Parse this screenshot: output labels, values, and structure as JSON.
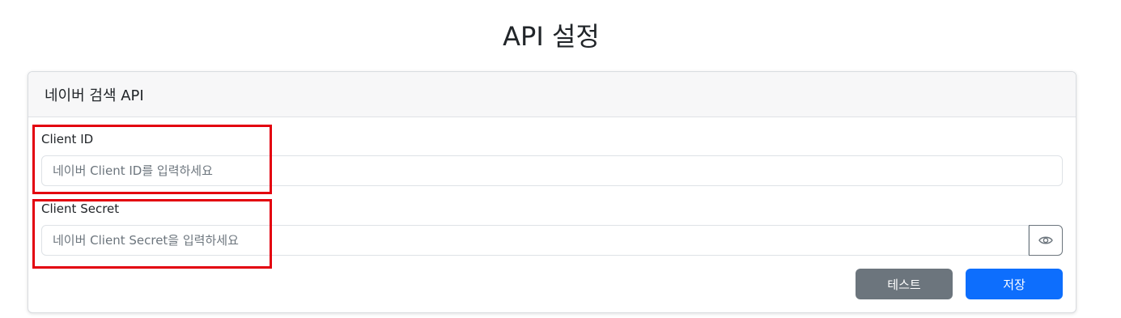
{
  "page": {
    "title": "API 설정"
  },
  "card": {
    "header": "네이버 검색 API",
    "client_id": {
      "label": "Client ID",
      "value": "",
      "placeholder": "네이버 Client ID를 입력하세요"
    },
    "client_secret": {
      "label": "Client Secret",
      "value": "",
      "placeholder": "네이버 Client Secret을 입력하세요",
      "toggle_icon": "eye-icon"
    },
    "buttons": {
      "test_label": "테스트",
      "save_label": "저장"
    }
  },
  "colors": {
    "primary": "#0d6efd",
    "secondary": "#6c757d",
    "highlight": "#e3000f"
  }
}
